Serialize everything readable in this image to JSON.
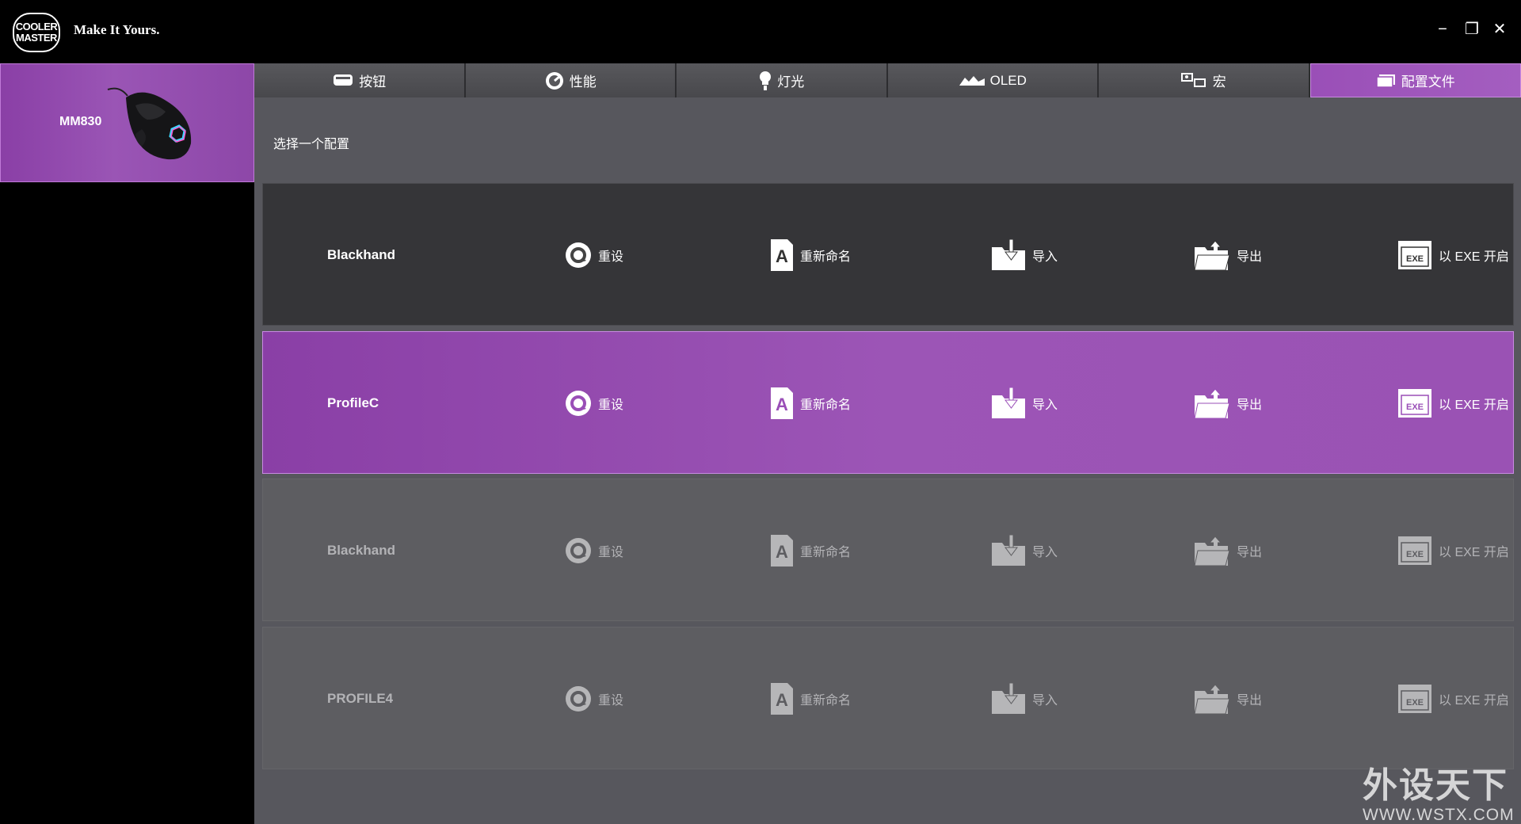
{
  "app": {
    "logo_lines": [
      "COOLER",
      "MASTER"
    ],
    "tagline": "Make It Yours.",
    "window_controls": {
      "minimize": "−",
      "maximize": "❐",
      "close": "✕"
    }
  },
  "device": {
    "name": "MM830"
  },
  "tabs": [
    {
      "label": "按钮",
      "icon": "mouse-button-icon"
    },
    {
      "label": "性能",
      "icon": "performance-gauge-icon"
    },
    {
      "label": "灯光",
      "icon": "light-bulb-icon"
    },
    {
      "label": "OLED",
      "icon": "oled-display-icon"
    },
    {
      "label": "宏",
      "icon": "macro-icon"
    },
    {
      "label": "配置文件",
      "icon": "profile-icon",
      "active": true
    }
  ],
  "section_label": "选择一个配置",
  "actions": {
    "reset": "重设",
    "rename": "重新命名",
    "import": "导入",
    "export": "导出",
    "exe": "以 EXE 开启",
    "exe_badge": "EXE"
  },
  "profiles": [
    {
      "name": "Blackhand",
      "state": "default"
    },
    {
      "name": "ProfileC",
      "state": "selected"
    },
    {
      "name": "Blackhand",
      "state": "disabled"
    },
    {
      "name": "PROFILE4",
      "state": "disabled"
    }
  ],
  "watermark": {
    "text": "外设天下",
    "url": "WWW.WSTX.COM"
  },
  "colors": {
    "accent": "#9a4fb7",
    "panel": "#57575d",
    "row_dark": "#353538"
  }
}
